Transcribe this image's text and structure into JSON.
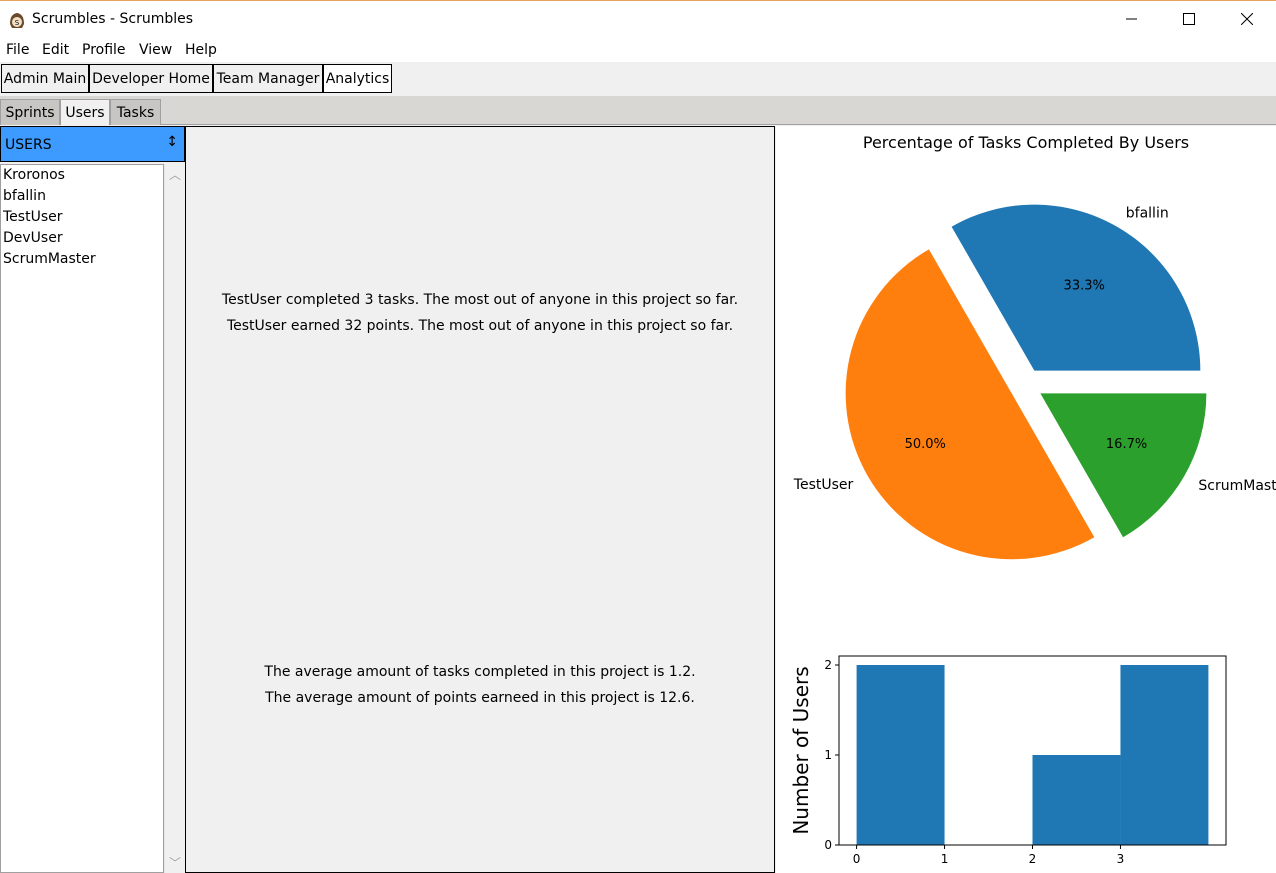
{
  "window": {
    "title": "Scrumbles - Scrumbles",
    "app_icon": "scrumbles-logo-icon",
    "controls": [
      "minimize-icon",
      "maximize-icon",
      "close-icon"
    ]
  },
  "menu": [
    "File",
    "Edit",
    "Profile",
    "View",
    "Help"
  ],
  "toolbar": {
    "buttons": [
      "Admin Main",
      "Developer Home",
      "Team Manager",
      "Analytics"
    ],
    "active": "Analytics"
  },
  "tabs": {
    "items": [
      "Sprints",
      "Users",
      "Tasks"
    ],
    "active": "Users"
  },
  "users_panel": {
    "header": "USERS",
    "sort_icon": "sort-updown-icon",
    "items": [
      "Kroronos",
      "bfallin",
      "TestUser",
      "DevUser",
      "ScrumMaster"
    ]
  },
  "stats": {
    "top_line1": "TestUser completed 3 tasks. The most out of anyone in this project so far.",
    "top_line2": "TestUser earned 32 points. The most out of anyone in this project so far.",
    "bottom_line1": "The average amount of tasks completed in this project is 1.2.",
    "bottom_line2": "The average amount of points earneed in this project is 12.6."
  },
  "colors": {
    "header_blue": "#3d9bff",
    "pie_blue": "#1f77b4",
    "pie_orange": "#ff7f0e",
    "pie_green": "#2ca02c",
    "bar_blue": "#1f77b4"
  },
  "chart_data": [
    {
      "type": "pie",
      "title": "Percentage of Tasks Completed By Users",
      "slices": [
        {
          "label": "bfallin",
          "value": 33.3,
          "pct_label": "33.3%",
          "color": "#1f77b4"
        },
        {
          "label": "TestUser",
          "value": 50.0,
          "pct_label": "50.0%",
          "color": "#ff7f0e"
        },
        {
          "label": "ScrumMaster",
          "value": 16.7,
          "pct_label": "16.7%",
          "color": "#2ca02c"
        }
      ],
      "exploded": true
    },
    {
      "type": "bar",
      "ylabel": "Number of Users",
      "xlabel": "",
      "bins": [
        [
          0,
          1
        ],
        [
          1,
          2
        ],
        [
          2,
          3
        ],
        [
          3,
          4
        ]
      ],
      "values": [
        2,
        0,
        1,
        2
      ],
      "xticks": [
        "0",
        "1",
        "2",
        "3"
      ],
      "yticks": [
        "0",
        "1",
        "2"
      ],
      "ylim": [
        0,
        2.1
      ],
      "xlim": [
        -0.2,
        4.2
      ]
    }
  ]
}
